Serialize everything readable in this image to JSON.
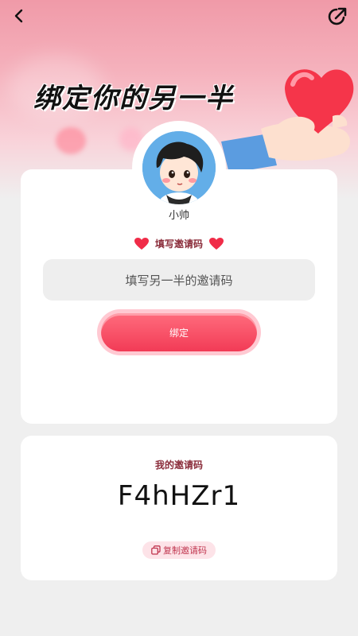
{
  "header": {
    "title": "绑定你的另一半"
  },
  "profile": {
    "name": "小帅"
  },
  "invite_form": {
    "section_label": "填写邀请码",
    "input_placeholder": "填写另一半的邀请码",
    "bind_label": "绑定"
  },
  "my_code": {
    "label": "我的邀请码",
    "code": "F4hHZr1",
    "copy_label": "复制邀请码"
  },
  "colors": {
    "accent": "#f23b56",
    "label": "#8a2c3a"
  }
}
